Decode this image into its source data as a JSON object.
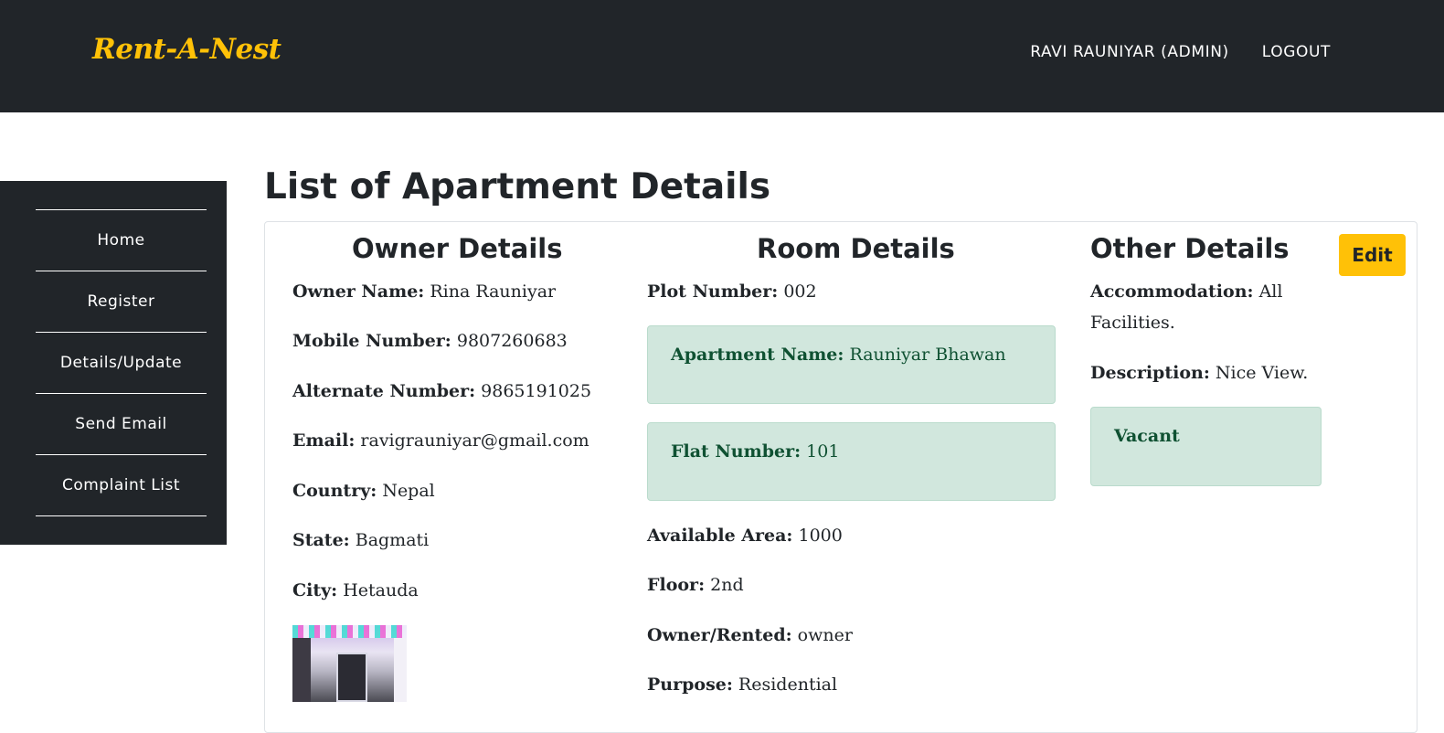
{
  "header": {
    "brand": "Rent-A-Nest",
    "user_label": "RAVI RAUNIYAR (ADMIN)",
    "logout_label": "LOGOUT"
  },
  "sidebar": {
    "items": [
      {
        "label": "Home"
      },
      {
        "label": "Register"
      },
      {
        "label": "Details/Update"
      },
      {
        "label": "Send Email"
      },
      {
        "label": "Complaint List"
      }
    ]
  },
  "main": {
    "title": "List of Apartment Details",
    "edit_label": "Edit",
    "owner": {
      "heading": "Owner Details",
      "fields": [
        {
          "label": "Owner Name:",
          "value": "Rina Rauniyar"
        },
        {
          "label": "Mobile Number:",
          "value": "9807260683"
        },
        {
          "label": "Alternate Number:",
          "value": "9865191025"
        },
        {
          "label": "Email:",
          "value": "ravigrauniyar@gmail.com"
        },
        {
          "label": "Country:",
          "value": "Nepal"
        },
        {
          "label": "State:",
          "value": "Bagmati"
        },
        {
          "label": "City:",
          "value": "Hetauda"
        }
      ]
    },
    "room": {
      "heading": "Room Details",
      "plot": {
        "label": "Plot Number:",
        "value": "002"
      },
      "apartment": {
        "label": "Apartment Name:",
        "value": "Rauniyar Bhawan"
      },
      "flat": {
        "label": "Flat Number:",
        "value": "101"
      },
      "fields": [
        {
          "label": "Available Area:",
          "value": "1000"
        },
        {
          "label": "Floor:",
          "value": "2nd"
        },
        {
          "label": "Owner/Rented:",
          "value": "owner"
        },
        {
          "label": "Purpose:",
          "value": "Residential"
        }
      ]
    },
    "other": {
      "heading": "Other Details",
      "accommodation_label": "Accommodation:",
      "accommodation_value": "All",
      "accommodation_value_cont": "Facilities.",
      "description": {
        "label": "Description:",
        "value": "Nice View."
      },
      "status": "Vacant"
    }
  },
  "colors": {
    "navbar": "#212529",
    "brand": "#ffc107",
    "alert_bg": "#d1e7dd",
    "alert_text": "#0f5132",
    "edit_button": "#ffc107"
  }
}
